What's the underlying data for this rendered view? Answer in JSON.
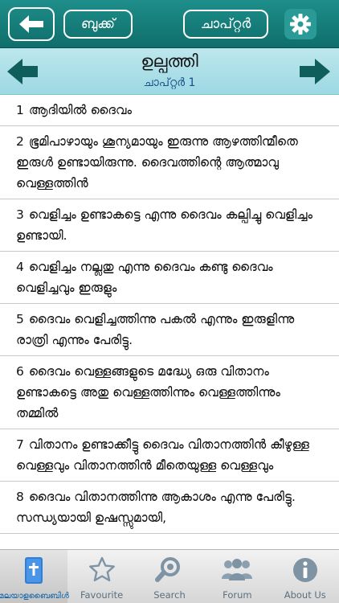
{
  "toolbar": {
    "back_icon": "arrow-left-icon",
    "book_label": "ബുക്ക്",
    "chapter_label": "ചാപ്റ്റർ",
    "settings_icon": "gear-icon"
  },
  "header": {
    "book_title": "ഉല്പത്തി",
    "chapter_label": "ചാപ്റ്റർ 1"
  },
  "verses": [
    {
      "num": "1",
      "text": "ആദിയിൽ ദൈവം"
    },
    {
      "num": "2",
      "text": "ഭൂമിപാഴായും ശൂന്യമായും ഇരുന്നു ആഴത്തിന്മീതെ ഇരുൾ ഉണ്ടായിരുന്നു. ദൈവത്തിന്റെ ആത്മാവു വെള്ളത്തിൻ"
    },
    {
      "num": "3",
      "text": "വെളിച്ചം ഉണ്ടാകട്ടെ എന്നു ദൈവം കല്പിച്ചു വെളിച്ചം ഉണ്ടായി."
    },
    {
      "num": "4",
      "text": "വെളിച്ചം നല്ലതു എന്നു ദൈവം കണ്ടു ദൈവം വെളിച്ചവും ഇരുളും"
    },
    {
      "num": "5",
      "text": "ദൈവം വെളിച്ചത്തിന്നു പകൽ എന്നും ഇരുളിന്നു രാത്രി എന്നും പേരിട്ടു."
    },
    {
      "num": "6",
      "text": "ദൈവം വെള്ളങ്ങളുടെ മദ്ധ്യേ ഒരു വിതാനം ഉണ്ടാകട്ടെ അതു വെള്ളത്തിന്നും വെള്ളത്തിന്നും തമ്മിൽ"
    },
    {
      "num": "7",
      "text": "വിതാനം ഉണ്ടാക്കീട്ടു ദൈവം വിതാനത്തിൻ കീഴുള്ള വെള്ളവും വിതാനത്തിൻ മീതെയുള്ള വെള്ളവും"
    },
    {
      "num": "8",
      "text": "ദൈവം വിതാനത്തിന്നു ആകാശം എന്നു പേരിട്ടു. സന്ധ്യയായി ഉഷസ്സുമായി,"
    }
  ],
  "tabs": [
    {
      "label": "മലയാളബൈബിൾ",
      "icon": "bible-book-icon"
    },
    {
      "label": "Favourite",
      "icon": "star-icon"
    },
    {
      "label": "Search",
      "icon": "magnifier-icon"
    },
    {
      "label": "Forum",
      "icon": "people-icon"
    },
    {
      "label": "About Us",
      "icon": "info-icon"
    }
  ],
  "colors": {
    "toolbar_bg": "#137a77",
    "chapter_band_bg": "#aee0e9",
    "chapter_label": "#1a4f8a",
    "active_tab_label": "#1a68a8"
  }
}
